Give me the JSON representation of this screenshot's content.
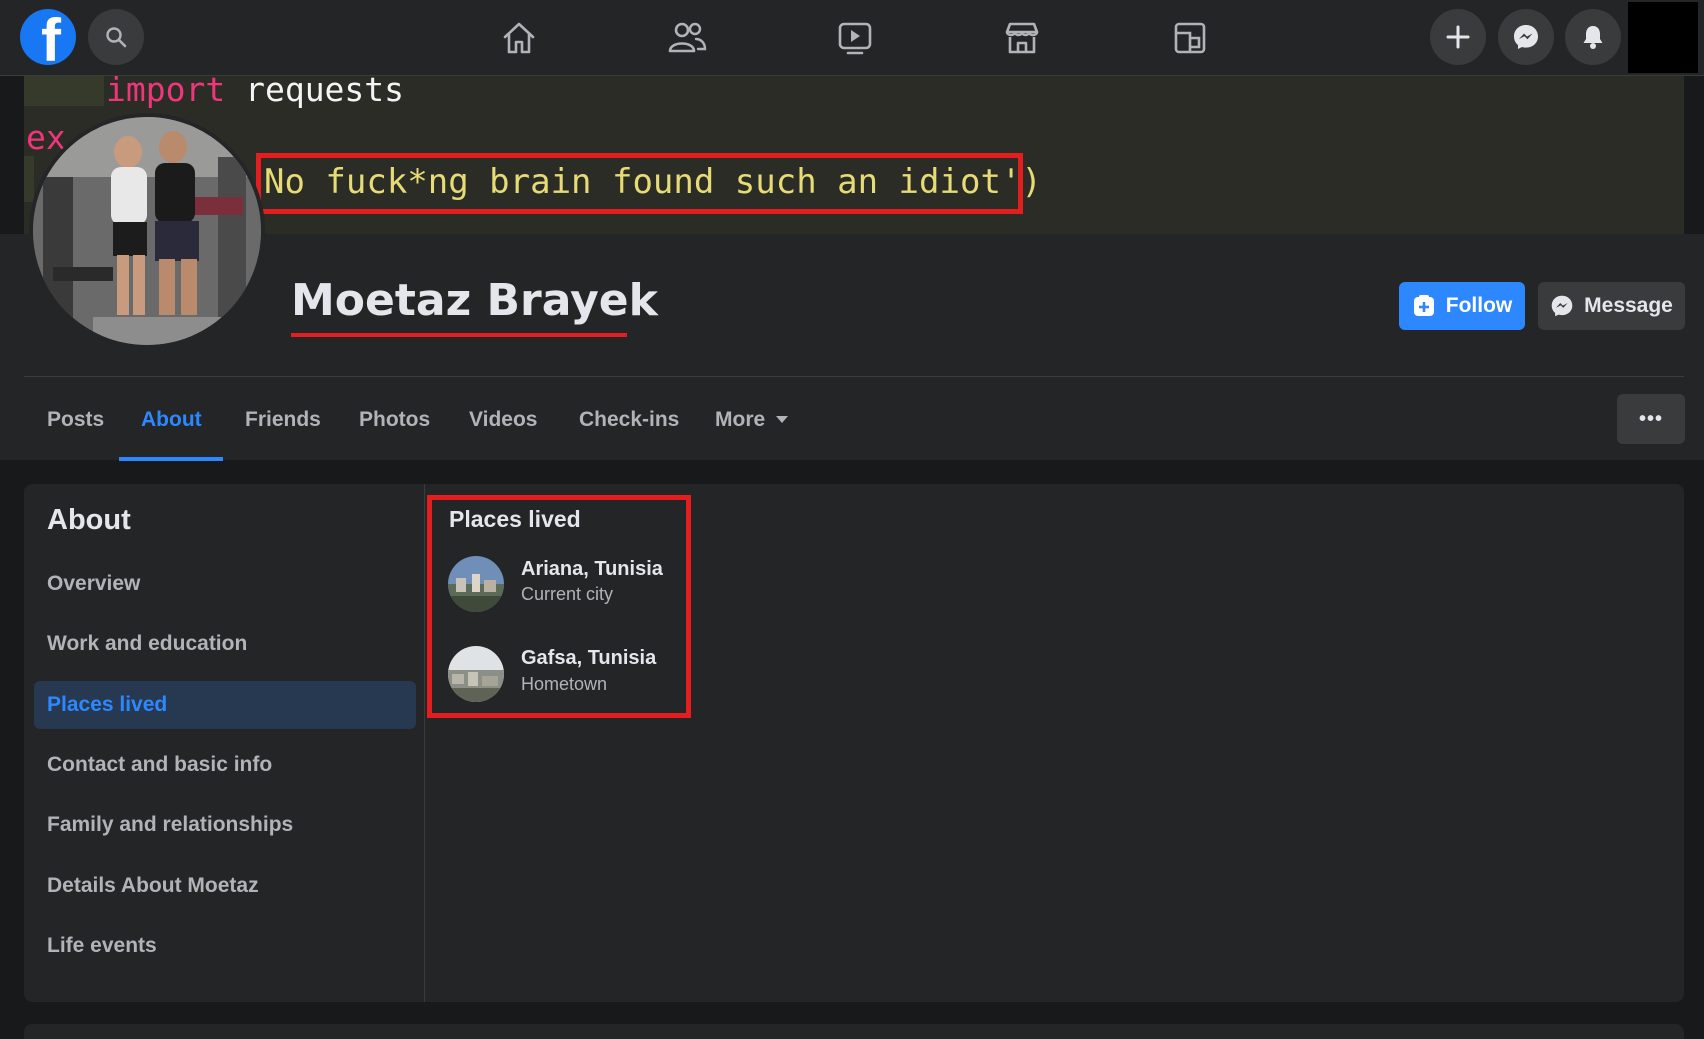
{
  "topbar": {
    "logo_letter": "f",
    "nav_icons": [
      "home-icon",
      "friends-icon",
      "watch-icon",
      "marketplace-icon",
      "gaming-icon"
    ],
    "action_icons": [
      "plus-icon",
      "messenger-icon",
      "notifications-icon"
    ]
  },
  "cover": {
    "line1_kw": "import",
    "line1_rest": " requests",
    "line2_partial": "ex",
    "highlighted_text": "No fuck*ng brain found such an idiot')"
  },
  "profile": {
    "name": "Moetaz Brayek",
    "follow_label": "Follow",
    "message_label": "Message"
  },
  "tabs": [
    {
      "label": "Posts",
      "active": false
    },
    {
      "label": "About",
      "active": true
    },
    {
      "label": "Friends",
      "active": false
    },
    {
      "label": "Photos",
      "active": false
    },
    {
      "label": "Videos",
      "active": false
    },
    {
      "label": "Check-ins",
      "active": false
    },
    {
      "label": "More",
      "active": false
    }
  ],
  "more_dots": "•••",
  "about": {
    "title": "About",
    "items": [
      "Overview",
      "Work and education",
      "Places lived",
      "Contact and basic info",
      "Family and relationships",
      "Details About Moetaz",
      "Life events"
    ],
    "active_item": "Places lived"
  },
  "places": {
    "title": "Places lived",
    "list": [
      {
        "name": "Ariana, Tunisia",
        "type": "Current city"
      },
      {
        "name": "Gafsa, Tunisia",
        "type": "Hometown"
      }
    ]
  },
  "colors": {
    "accent": "#2d88ff",
    "highlight_red": "#e41e1e",
    "surface": "#242526",
    "background": "#18191a"
  }
}
